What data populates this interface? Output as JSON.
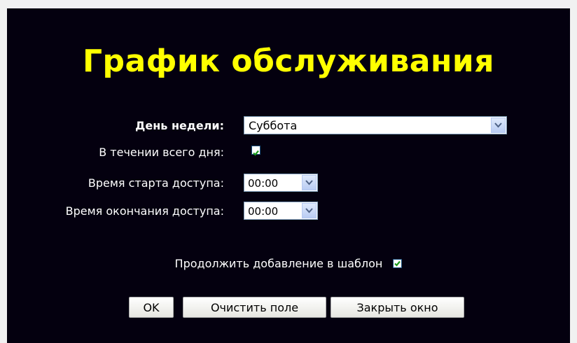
{
  "dialog": {
    "title": "График обслуживания"
  },
  "form": {
    "weekday": {
      "label": "День недели:",
      "value": "Суббота"
    },
    "all_day": {
      "label": "В течении всего дня:",
      "checked": true
    },
    "start_time": {
      "label": "Время старта доступа:",
      "value": "00:00"
    },
    "end_time": {
      "label": "Время окончания доступа:",
      "value": "00:00"
    },
    "continue_adding": {
      "label": "Продолжить добавление в шаблон",
      "checked": true
    }
  },
  "buttons": {
    "ok": "OK",
    "clear": "Очистить поле",
    "close": "Закрыть окно"
  },
  "colors": {
    "background": "#04000f",
    "title": "#ffff00",
    "text": "#ffffff",
    "check": "#1a9a1a"
  }
}
